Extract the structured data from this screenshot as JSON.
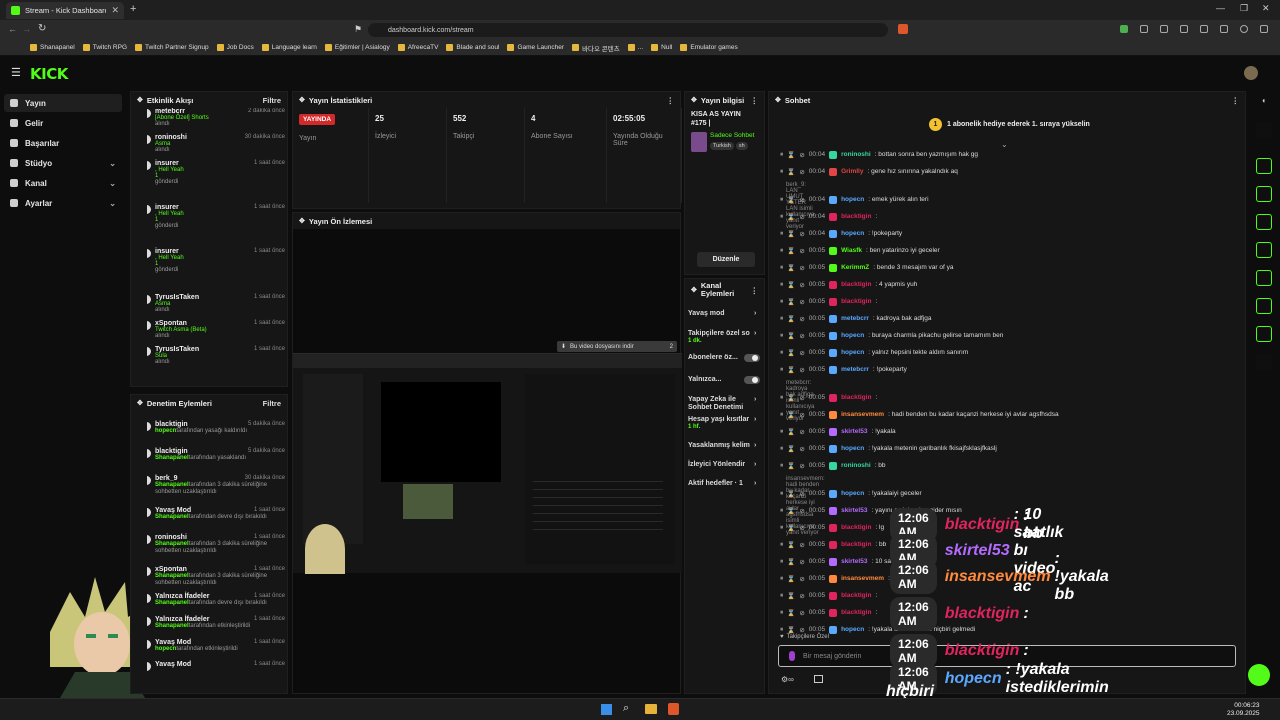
{
  "browser": {
    "tab_title": "Stream - Kick Dashboard",
    "url": "dashboard.kick.com/stream",
    "bookmarks": [
      "Shanapanel",
      "Twitch RPG",
      "Twitch Partner Signup",
      "Job Docs",
      "Language learn",
      "Eğitimler | Asialogy",
      "AfreecaTV",
      "Blade and soul",
      "Game Launcher",
      "바다오 콘텐츠",
      "...",
      "Null",
      "Emulator games"
    ]
  },
  "kick": {
    "logo": "KICK"
  },
  "sidebar": {
    "items": [
      {
        "label": "Yayın",
        "active": true,
        "chevron": false
      },
      {
        "label": "Gelir",
        "active": false,
        "chevron": false
      },
      {
        "label": "Başarılar",
        "active": false,
        "chevron": false
      },
      {
        "label": "Stüdyo",
        "active": false,
        "chevron": true
      },
      {
        "label": "Kanal",
        "active": false,
        "chevron": true
      },
      {
        "label": "Ayarlar",
        "active": false,
        "chevron": true
      }
    ]
  },
  "activity": {
    "title": "Etkinlik Akışı",
    "filter": "Filtre",
    "events": [
      {
        "name": "metebcrr",
        "time": "2 dakika önce",
        "detail": "[Abone Özel] Shorts",
        "suffix": "alındı"
      },
      {
        "name": "roninoshi",
        "time": "30 dakika önce",
        "detail": "Asma",
        "suffix": "alındı"
      },
      {
        "name": "insurer",
        "time": "1 saat önce",
        "detail": ", Hell Yeah",
        "amount": "1",
        "suffix": "gönderdi"
      },
      {
        "name": "insurer",
        "time": "1 saat önce",
        "detail": ", Hell Yeah",
        "amount": "1",
        "suffix": "gönderdi"
      },
      {
        "name": "insurer",
        "time": "1 saat önce",
        "detail": ", Hell Yeah",
        "amount": "1",
        "suffix": "gönderdi"
      },
      {
        "name": "TyrusIsTaken",
        "time": "1 saat önce",
        "detail": "Asma",
        "suffix": "alındı"
      },
      {
        "name": "xSpontan",
        "time": "1 saat önce",
        "detail": "Twitch Asma (Beta)",
        "suffix": "alındı"
      },
      {
        "name": "TyrusIsTaken",
        "time": "1 saat önce",
        "detail": "Sula",
        "suffix": "alındı"
      }
    ]
  },
  "moderation": {
    "title": "Denetim Eylemleri",
    "filter": "Filtre",
    "events": [
      {
        "name": "blacktigin",
        "time": "5 dakika önce",
        "who": "hopecn",
        "text": "tarafından yasağı kaldırıldı"
      },
      {
        "name": "blacktigin",
        "time": "5 dakika önce",
        "who": "Shanapanel",
        "text": "tarafından yasaklandı"
      },
      {
        "name": "berk_9",
        "time": "30 dakika önce",
        "who": "Shanapanel",
        "text": "tarafından 3 dakika süreliğine sohbetten uzaklaştırıldı"
      },
      {
        "name": "Yavaş Mod",
        "time": "1 saat önce",
        "who": "Shanapanel",
        "text": "tarafından devre dışı bırakıldı"
      },
      {
        "name": "roninoshi",
        "time": "1 saat önce",
        "who": "Shanapanel",
        "text": "tarafından 3 dakika süreliğine sohbetten uzaklaştırıldı"
      },
      {
        "name": "xSpontan",
        "time": "1 saat önce",
        "who": "Shanapanel",
        "text": "tarafından 3 dakika süreliğine sohbetten uzaklaştırıldı"
      },
      {
        "name": "Yalnızca İfadeler",
        "time": "1 saat önce",
        "who": "Shanapanel",
        "text": "tarafından devre dışı bırakıldı"
      },
      {
        "name": "Yalnızca İfadeler",
        "time": "1 saat önce",
        "who": "Shanapanel",
        "text": "tarafından etkinleştirildi"
      },
      {
        "name": "Yavaş Mod",
        "time": "1 saat önce",
        "who": "hopecn",
        "text": "tarafından etkinleştirildi"
      },
      {
        "name": "Yavaş Mod",
        "time": "1 saat önce",
        "who": "",
        "text": ""
      }
    ]
  },
  "stats": {
    "title": "Yayın İstatistikleri",
    "cells": [
      {
        "value": "YAYINDA",
        "label": "Yayın",
        "live": true
      },
      {
        "value": "25",
        "label": "İzleyici"
      },
      {
        "value": "552",
        "label": "Takipçi"
      },
      {
        "value": "4",
        "label": "Abone Sayısı"
      },
      {
        "value": "02:55:05",
        "label": "Yayında Olduğu Süre"
      }
    ]
  },
  "preview": {
    "title": "Yayın Ön İzlemesi",
    "download_hint": "Bu video dosyasını indir",
    "download_count": "2"
  },
  "info": {
    "title": "Yayın bilgisi",
    "stream_title": "KISA AS YAYIN #175 |",
    "category": "Sadece Sohbet",
    "tags": [
      "Turkish",
      "sh"
    ],
    "edit": "Düzenle"
  },
  "channel_actions": {
    "title": "Kanal Eylemleri",
    "items": [
      {
        "label": "Yavaş mod",
        "sub": ""
      },
      {
        "label": "Takipçilere özel so",
        "sub": "1 dk."
      },
      {
        "label": "Abonelere öz...",
        "sub": "",
        "toggle": true
      },
      {
        "label": "Yalnızca...",
        "sub": "",
        "toggle": true
      },
      {
        "label": "Yapay Zeka ile Sohbet Denetimi",
        "sub": ""
      },
      {
        "label": "Hesap yaşı kısıtlar",
        "sub": "1 hf."
      },
      {
        "label": "Yasaklanmış kelim",
        "sub": ""
      },
      {
        "label": "İzleyici Yönlendir",
        "sub": ""
      },
      {
        "label": "Aktif hedefler · 1",
        "sub": ""
      }
    ]
  },
  "chat": {
    "title": "Sohbet",
    "pinned": "1 abonelik hediye ederek 1. sıraya yükselin",
    "lines": [
      {
        "ts": "00:04",
        "user": "roninoshi",
        "color": "#36d6a0",
        "msg": ": bottan sonra ben yazmışım hak gg"
      },
      {
        "ts": "00:04",
        "user": "Grimlly",
        "color": "#e04646",
        "msg": ": gene hız sınırına yakalndık aq"
      },
      {
        "sys": "berk_9: LAN UMUT YETER LAN isimli kullanıcıya yanıt veriyor"
      },
      {
        "ts": "00:04",
        "user": "hopecn",
        "color": "#5aa9ff",
        "msg": ": emek yürek alın teri"
      },
      {
        "ts": "00:04",
        "user": "blacktigin",
        "color": "#e0245e",
        "msg": ":"
      },
      {
        "ts": "00:04",
        "user": "hopecn",
        "color": "#5aa9ff",
        "msg": ": !pokeparty"
      },
      {
        "ts": "00:05",
        "user": "Wiasfk",
        "color": "#53fc18",
        "msg": ": ben yatarinzo iyi geceler"
      },
      {
        "ts": "00:05",
        "user": "KerimmZ",
        "color": "#53fc18",
        "msg": ": bende 3 mesajım var of ya"
      },
      {
        "ts": "00:05",
        "user": "blacktigin",
        "color": "#e0245e",
        "msg": ": 4 yapmis yuh"
      },
      {
        "ts": "00:05",
        "user": "blacktigin",
        "color": "#e0245e",
        "msg": ":"
      },
      {
        "ts": "00:05",
        "user": "metebcrr",
        "color": "#5aa9ff",
        "msg": ": kadroya bak adfjga"
      },
      {
        "ts": "00:05",
        "user": "hopecn",
        "color": "#5aa9ff",
        "msg": ": buraya charmla pikachu gelirse tamamım ben"
      },
      {
        "ts": "00:05",
        "user": "hopecn",
        "color": "#5aa9ff",
        "msg": ": yalnız hepsini tekte aldım sanırım"
      },
      {
        "ts": "00:05",
        "user": "metebcrr",
        "color": "#5aa9ff",
        "msg": ": !pokeparty"
      },
      {
        "sys": "metebcrr: kadroya bak adfjga isimli kullanıcıya yanıt veriyor"
      },
      {
        "ts": "00:05",
        "user": "blacktigin",
        "color": "#e0245e",
        "msg": ":"
      },
      {
        "ts": "00:05",
        "user": "insansevmem",
        "color": "#ff8a3d",
        "msg": ": hadi benden bu kadar kaçanzi herkese iyi avlar agsfhsdsa"
      },
      {
        "ts": "00:05",
        "user": "skirtel53",
        "color": "#b36bff",
        "msg": ": !yakala"
      },
      {
        "ts": "00:05",
        "user": "hopecn",
        "color": "#5aa9ff",
        "msg": ": !yakala metenin garibanlık fkisajfsklasjfkaslj"
      },
      {
        "ts": "00:05",
        "user": "roninoshi",
        "color": "#36d6a0",
        "msg": ": bb"
      },
      {
        "sys": "insansevmem: hadi benden bu kadar kaçanzi herkese iyi avlar agsfhsdsa isimli kullanıcıya yanıt veriyor"
      },
      {
        "ts": "00:05",
        "user": "hopecn",
        "color": "#5aa9ff",
        "msg": ": !yakalaiyi geceler"
      },
      {
        "ts": "00:05",
        "user": "skirtel53",
        "color": "#b36bff",
        "msg": ": yayını acık bırakıp gider mısın"
      },
      {
        "ts": "00:05",
        "user": "blacktigin",
        "color": "#e0245e",
        "msg": ": lg"
      },
      {
        "ts": "00:05",
        "user": "blacktigin",
        "color": "#e0245e",
        "msg": ": bb"
      },
      {
        "ts": "00:05",
        "user": "skirtel53",
        "color": "#b36bff",
        "msg": ": 10 saatlık"
      },
      {
        "ts": "00:05",
        "user": "insansevmem",
        "color": "#ff8a3d",
        "msg": ": !yakala bb"
      },
      {
        "ts": "00:05",
        "user": "blacktigin",
        "color": "#e0245e",
        "msg": ":"
      },
      {
        "ts": "00:05",
        "user": "blacktigin",
        "color": "#e0245e",
        "msg": ":"
      },
      {
        "ts": "00:05",
        "user": "hopecn",
        "color": "#5aa9ff",
        "msg": ": !yakala istediklerimin hiçbiri gelmedi"
      }
    ],
    "followers_only": "Takipçilere Özel",
    "input_placeholder": "Bir mesaj gönderin"
  },
  "overlay": [
    {
      "time": "12:06 AM",
      "user": "blacktigin",
      "color": "#e0245e",
      "msg": ": bb"
    },
    {
      "time": "12:06 AM",
      "user": "skirtel53",
      "color": "#b36bff",
      "msg": ": 10 saatlık bı video ac"
    },
    {
      "time": "12:06 AM",
      "user": "insansevmem",
      "color": "#ff8a3d",
      "msg": ": !yakala bb"
    },
    {
      "time": "12:06 AM",
      "user": "blacktigin",
      "color": "#e0245e",
      "msg": ":"
    },
    {
      "time": "12:06 AM",
      "user": "blacktigin",
      "color": "#e0245e",
      "msg": ":"
    },
    {
      "time": "12:06 AM",
      "user": "hopecn",
      "color": "#5aa9ff",
      "msg": ": !yakala istediklerimin"
    },
    {
      "time": "",
      "user": "",
      "color": "#ffffff",
      "msg": "hiçbiri gelmedi"
    }
  ],
  "taskbar": {
    "time": "00:06:23",
    "date": "23.09.2025"
  },
  "colors": {
    "accent": "#53fc18",
    "live": "#d12a2a"
  }
}
